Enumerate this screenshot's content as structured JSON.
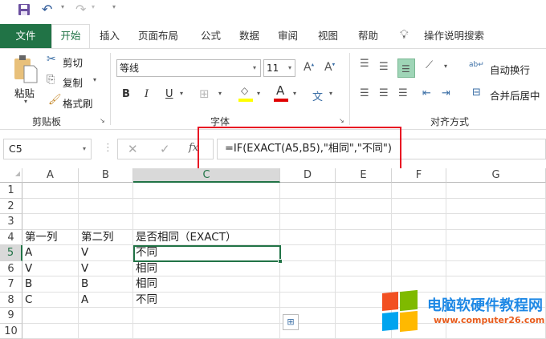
{
  "qat": {
    "save": "save-icon",
    "undo": "undo-icon",
    "redo": "redo-icon"
  },
  "tabs": [
    "文件",
    "开始",
    "插入",
    "页面布局",
    "公式",
    "数据",
    "审阅",
    "视图",
    "帮助"
  ],
  "tell_me": "操作说明搜索",
  "clipboard": {
    "paste": "粘贴",
    "cut": "剪切",
    "copy": "复制",
    "format_painter": "格式刷",
    "label": "剪贴板"
  },
  "font": {
    "name": "等线",
    "size": "11",
    "bold": "B",
    "italic": "I",
    "underline": "U",
    "font_color_glyph": "A",
    "phonetic": "文",
    "label": "字体",
    "fill_color": "#ffff00",
    "text_color": "#e00000"
  },
  "alignment": {
    "wrap": "自动换行",
    "merge": "合并后居中",
    "label": "对齐方式"
  },
  "formula_bar": {
    "name_box": "C5",
    "formula": "=IF(EXACT(A5,B5),\"相同\",\"不同\")",
    "fx": "fx"
  },
  "columns": [
    "A",
    "B",
    "C",
    "D",
    "E",
    "F",
    "G"
  ],
  "rows": [
    "1",
    "2",
    "3",
    "4",
    "5",
    "6",
    "7",
    "8",
    "9",
    "10"
  ],
  "cells": [
    [
      "",
      "",
      ""
    ],
    [
      "",
      "",
      ""
    ],
    [
      "",
      "",
      ""
    ],
    [
      "第一列",
      "第二列",
      "是否相同（EXACT）"
    ],
    [
      "A",
      "V",
      "不同"
    ],
    [
      "V",
      "V",
      "相同"
    ],
    [
      "B",
      "B",
      "相同"
    ],
    [
      "C",
      "A",
      "不同"
    ],
    [
      "",
      "",
      ""
    ],
    [
      "",
      "",
      ""
    ]
  ],
  "watermark": {
    "title": "电脑软硬件教程网",
    "url": "www.computer26.com"
  },
  "accent": "#217346",
  "highlight": "#e81123"
}
